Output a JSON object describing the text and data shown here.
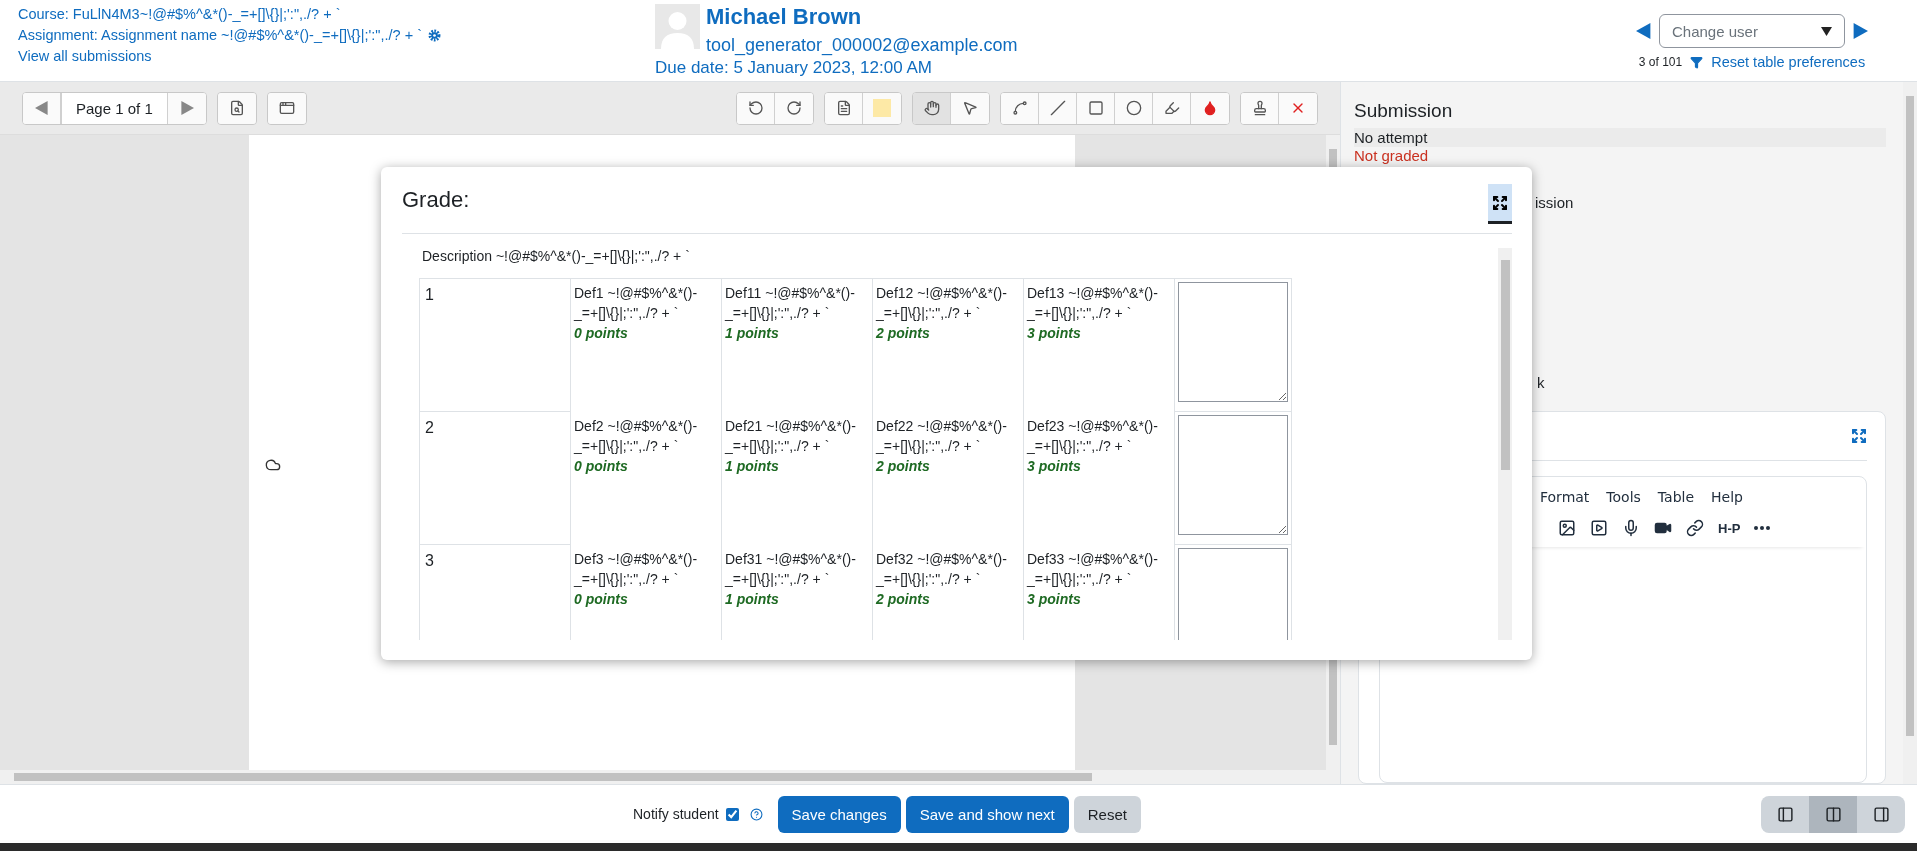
{
  "header": {
    "course": "Course: FuLlN4M3~!@#$%^&*()-_=+[]\\{}|;':\",./? + `",
    "assignment": "Assignment: Assignment name ~!@#$%^&*()-_=+[]\\{}|;':\",./? + `",
    "view_all": "View all submissions"
  },
  "user": {
    "name": "Michael Brown",
    "email": "tool_generator_000002@example.com",
    "due": "Due date: 5 January 2023, 12:00 AM"
  },
  "user_nav": {
    "placeholder": "Change user",
    "count": "3 of 101",
    "reset": "Reset table preferences"
  },
  "toolbar": {
    "page": "Page 1 of 1",
    "groups": [
      [
        {
          "kind": "rotate-left",
          "selected": false
        },
        {
          "kind": "rotate-right",
          "selected": false
        }
      ],
      [
        {
          "kind": "comment",
          "selected": false
        },
        {
          "kind": "color",
          "selected": false
        }
      ],
      [
        {
          "kind": "hand",
          "selected": true
        },
        {
          "kind": "pointer",
          "selected": false
        }
      ],
      [
        {
          "kind": "pen",
          "selected": false
        },
        {
          "kind": "line",
          "selected": false
        },
        {
          "kind": "rectangle",
          "selected": false
        },
        {
          "kind": "oval",
          "selected": false
        },
        {
          "kind": "highlighter",
          "selected": false
        },
        {
          "kind": "drop",
          "selected": false
        }
      ],
      [
        {
          "kind": "stamp",
          "selected": false
        },
        {
          "kind": "delete",
          "selected": false
        }
      ]
    ]
  },
  "grade_modal": {
    "title": "Grade:",
    "description": "Description ~!@#$%^&*()-_=+[]\\{}|;':\",./? + `",
    "criteria": [
      {
        "label": "1",
        "levels": [
          {
            "definition": "Def1 ~!@#$%^&*()-_=+[]\\{}|;':\",./? + `",
            "points": "0 points"
          },
          {
            "definition": "Def11 ~!@#$%^&*()-_=+[]\\{}|;':\",./? + `",
            "points": "1 points"
          },
          {
            "definition": "Def12 ~!@#$%^&*()-_=+[]\\{}|;':\",./? + `",
            "points": "2 points"
          },
          {
            "definition": "Def13 ~!@#$%^&*()-_=+[]\\{}|;':\",./? + `",
            "points": "3 points"
          }
        ]
      },
      {
        "label": "2",
        "levels": [
          {
            "definition": "Def2 ~!@#$%^&*()-_=+[]\\{}|;':\",./? + `",
            "points": "0 points"
          },
          {
            "definition": "Def21 ~!@#$%^&*()-_=+[]\\{}|;':\",./? + `",
            "points": "1 points"
          },
          {
            "definition": "Def22 ~!@#$%^&*()-_=+[]\\{}|;':\",./? + `",
            "points": "2 points"
          },
          {
            "definition": "Def23 ~!@#$%^&*()-_=+[]\\{}|;':\",./? + `",
            "points": "3 points"
          }
        ]
      },
      {
        "label": "3",
        "levels": [
          {
            "definition": "Def3 ~!@#$%^&*()-_=+[]\\{}|;':\",./? + `",
            "points": "0 points"
          },
          {
            "definition": "Def31 ~!@#$%^&*()-_=+[]\\{}|;':\",./? + `",
            "points": "1 points"
          },
          {
            "definition": "Def32 ~!@#$%^&*()-_=+[]\\{}|;':\",./? + `",
            "points": "2 points"
          },
          {
            "definition": "Def33 ~!@#$%^&*()-_=+[]\\{}|;':\",./? + `",
            "points": "3 points"
          }
        ]
      }
    ]
  },
  "submission": {
    "title": "Submission",
    "status": "No attempt",
    "grading": "Not graded",
    "fragment_1": "ission",
    "fragment_2": "k"
  },
  "feedback_editor": {
    "menu": [
      "Format",
      "Tools",
      "Table",
      "Help"
    ],
    "tools": [
      {
        "kind": "image"
      },
      {
        "kind": "media"
      },
      {
        "kind": "audio"
      },
      {
        "kind": "video"
      },
      {
        "kind": "link"
      },
      {
        "kind": "text",
        "label": "H-P"
      },
      {
        "kind": "more"
      }
    ]
  },
  "footer": {
    "notify": {
      "label": "Notify student",
      "checked": true
    },
    "buttons": [
      {
        "label": "Save changes",
        "kind": "primary"
      },
      {
        "label": "Save and show next",
        "kind": "primary"
      },
      {
        "label": "Reset",
        "kind": "secondary"
      }
    ],
    "layouts": [
      {
        "kind": "left",
        "selected": false
      },
      {
        "kind": "both",
        "selected": true
      },
      {
        "kind": "right",
        "selected": false
      }
    ]
  }
}
